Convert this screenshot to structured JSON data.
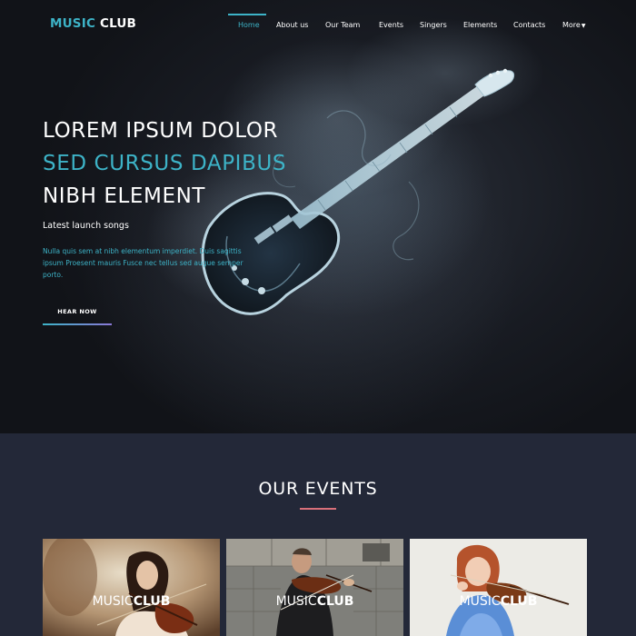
{
  "brand": {
    "part1": "MUSIC",
    "part2": "CLUB"
  },
  "nav": {
    "items": [
      {
        "label": "Home",
        "active": true
      },
      {
        "label": "About us"
      },
      {
        "label": "Our Team"
      },
      {
        "label": "Events"
      },
      {
        "label": "Singers"
      },
      {
        "label": "Elements"
      },
      {
        "label": "Contacts"
      },
      {
        "label": "More",
        "dropdown": true
      }
    ]
  },
  "hero": {
    "line1": "LOREM IPSUM DOLOR",
    "line2": "SED CURSUS DAPIBUS",
    "line3": "NIBH ELEMENT",
    "subheading": "Latest launch songs",
    "paragraph": "Nulla quis sem at nibh elementum imperdiet. Duis sagittis ipsum Proesent mauris Fusce nec tellus sed augue semper porto.",
    "button": "HEAR NOW"
  },
  "events": {
    "title": "OUR EVENTS",
    "cards": [
      {
        "label1": "MUSIC",
        "label2": "CLUB"
      },
      {
        "label1": "MUSIC",
        "label2": "CLUB"
      },
      {
        "label1": "MUSIC",
        "label2": "CLUB"
      }
    ]
  },
  "colors": {
    "accent": "#3db3c7",
    "background": "#232838",
    "divider": "#d9707a"
  }
}
